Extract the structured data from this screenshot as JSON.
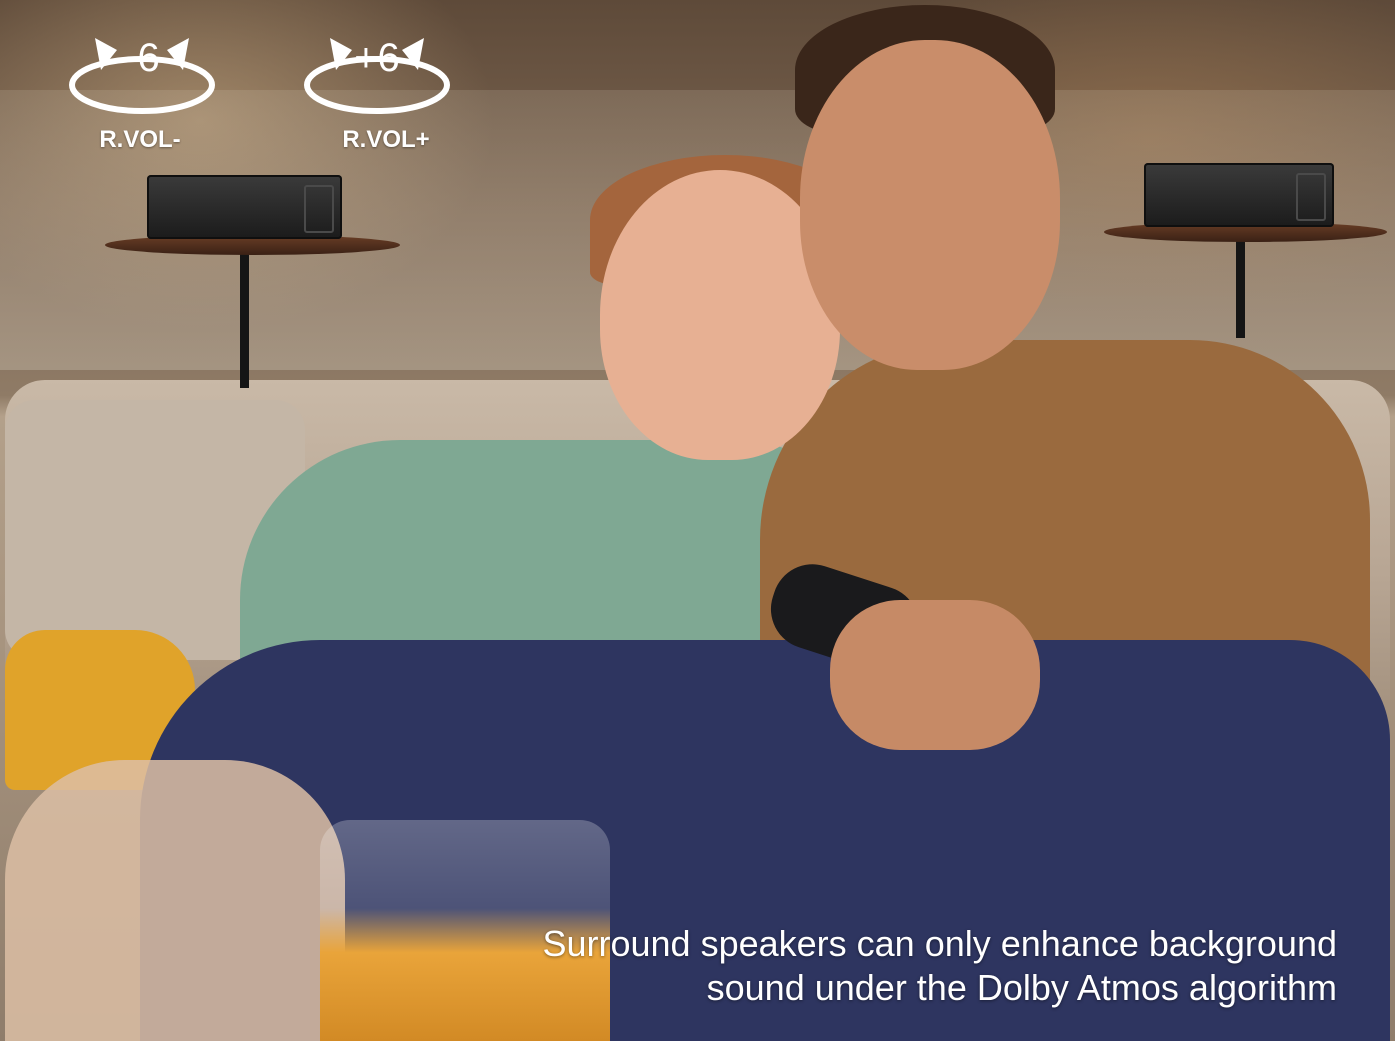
{
  "controls": [
    {
      "value": "-6",
      "label": "R.VOL-"
    },
    {
      "value": "+6",
      "label": "R.VOL+"
    }
  ],
  "caption": {
    "line1": "Surround speakers can only enhance background",
    "line2": "sound under the Dolby Atmos algorithm"
  }
}
